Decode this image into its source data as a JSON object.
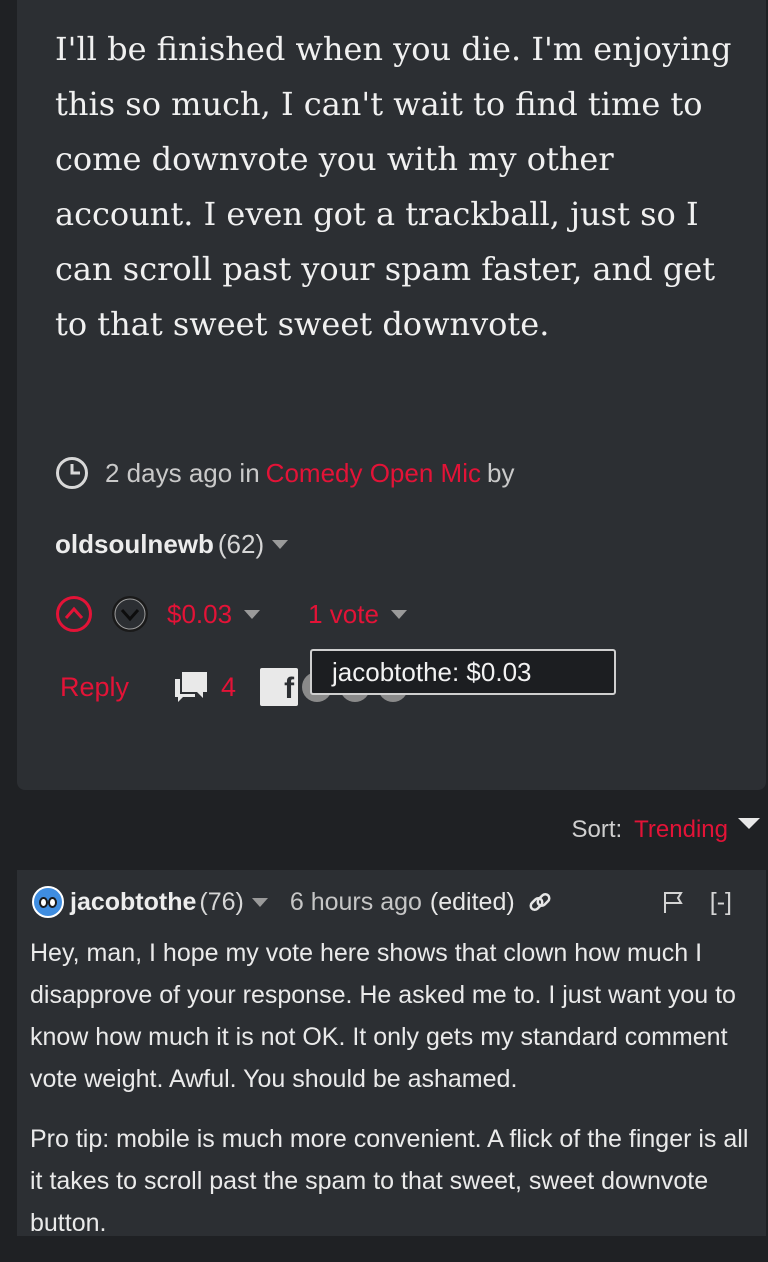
{
  "post": {
    "body": "I'll be finished when you die. I'm enjoying this so much, I can't wait to find time to come downvote you with my other account. I even got a trackball, just so I can scroll past your spam faster, and get to that sweet sweet downvote.",
    "time": "2 days ago in",
    "community": "Comedy Open Mic",
    "by": "by",
    "author": "oldsoulnewb",
    "reputation": "(62)",
    "payout": "$0.03",
    "votes": "1 vote",
    "reply": "Reply",
    "comments_count": "4",
    "facebook_glyph": "f",
    "tooltip": "jacobtothe: $0.03"
  },
  "sort": {
    "label": "Sort:",
    "value": "Trending"
  },
  "comment": {
    "author": "jacobtothe",
    "reputation": "(76)",
    "time": "6 hours ago",
    "edited": "(edited)",
    "collapse": "[-]",
    "paragraph1": "Hey, man, I hope my vote here shows that clown how much I disapprove of your response. He asked me to. I just want you to know how much it is not OK. It only gets my standard comment vote weight. Awful. You should be ashamed.",
    "paragraph2": "Pro tip: mobile is much more convenient. A flick of the finger is all it takes to scroll past the spam to that sweet, sweet downvote button."
  },
  "colors": {
    "accent": "#e31337",
    "card": "#2c2f33",
    "background": "#1f2124"
  }
}
